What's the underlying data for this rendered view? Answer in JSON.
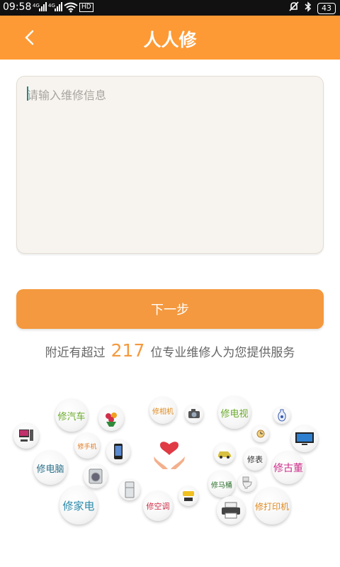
{
  "status_bar": {
    "time": "09:58",
    "signal1": "4G",
    "signal2": "4G",
    "network": "HD",
    "battery": "43"
  },
  "header": {
    "title": "人人修"
  },
  "form": {
    "placeholder": "请输入维修信息",
    "next_button": "下一步"
  },
  "nearby": {
    "prefix": "附近有超过",
    "count": "217",
    "suffix": "位专业维修人为您提供服务"
  },
  "services": [
    {
      "label": "修汽车",
      "color": "#6aaa2a"
    },
    {
      "label": "修相机",
      "color": "#e08a1e"
    },
    {
      "label": "修电视",
      "color": "#6aaa2a"
    },
    {
      "label": "修手机",
      "color": "#e0781e"
    },
    {
      "label": "修电脑",
      "color": "#2a6f8a"
    },
    {
      "label": "修表",
      "color": "#333333"
    },
    {
      "label": "修古董",
      "color": "#cc2f8a"
    },
    {
      "label": "修马桶",
      "color": "#2a6f2a"
    },
    {
      "label": "修家电",
      "color": "#2a8aaa"
    },
    {
      "label": "修空调",
      "color": "#d0304a"
    },
    {
      "label": "修打印机",
      "color": "#e08a1e"
    }
  ],
  "icons": {
    "back": "chevron-left-icon",
    "heart": "heart-hands-icon",
    "computer": "computer-icon",
    "flowers": "flowers-icon",
    "camera": "camera-icon",
    "vase": "vase-icon",
    "tv": "tv-icon",
    "watch": "watch-icon",
    "car": "car-icon",
    "phone": "phone-icon",
    "washer": "washer-icon",
    "fridge": "fridge-icon",
    "ac": "aircon-icon",
    "toilet": "toilet-icon",
    "printer": "printer-icon"
  },
  "colors": {
    "accent": "#fd9a35",
    "button": "#f4993f",
    "count": "#f4993f"
  }
}
